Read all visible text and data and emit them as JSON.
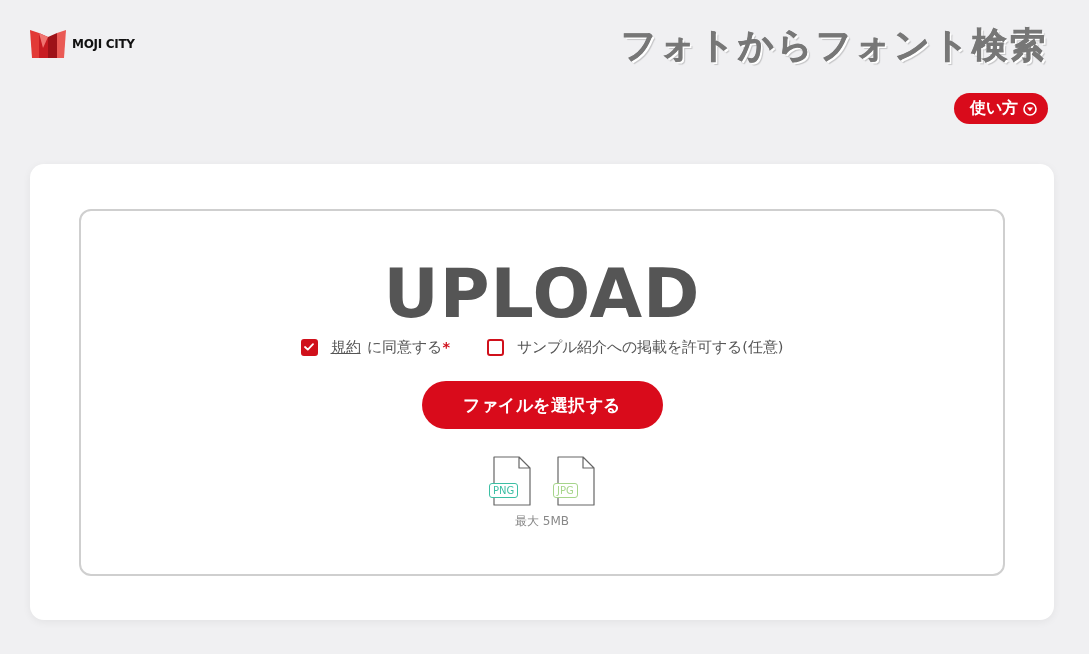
{
  "header": {
    "logo_text": "MOJI CITY",
    "title": "フォトからフォント検索",
    "help_button": "使い方"
  },
  "upload": {
    "heading": "UPLOAD",
    "agreements": [
      {
        "link": "規約",
        "label": "に同意する",
        "required_mark": "*",
        "checked": true
      },
      {
        "label": "サンプル紹介への掲載を許可する(任意)",
        "checked": false
      }
    ],
    "select_button": "ファイルを選択する",
    "file_types": [
      {
        "label": "PNG",
        "color": "#3cbfa4"
      },
      {
        "label": "JPG",
        "color": "#a6d58b"
      }
    ],
    "max_size": "最大 5MB"
  }
}
